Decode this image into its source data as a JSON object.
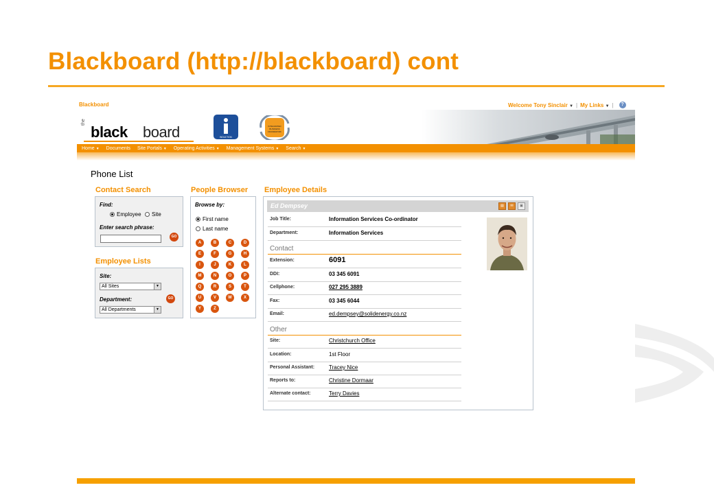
{
  "slide": {
    "title": "Blackboard (http://blackboard) cont"
  },
  "header": {
    "app_name": "Blackboard",
    "welcome": "Welcome Tony Sinclair",
    "my_links": "My Links",
    "logo_the": "the",
    "logo_bold": "black",
    "logo_thin": "board",
    "help_glyph": "?",
    "induction_label": "INDUCTION",
    "ibf_label": "INTEGRATED BUSINESS FRAMEWORK"
  },
  "nav": [
    {
      "label": "Home",
      "dropdown": true
    },
    {
      "label": "Documents",
      "dropdown": false
    },
    {
      "label": "Site Portals",
      "dropdown": true
    },
    {
      "label": "Operating Activities",
      "dropdown": true
    },
    {
      "label": "Management Systems",
      "dropdown": true
    },
    {
      "label": "Search",
      "dropdown": true
    }
  ],
  "page": {
    "heading": "Phone List"
  },
  "contact_search": {
    "title": "Contact Search",
    "find_label": "Find:",
    "option_employee": "Employee",
    "option_site": "Site",
    "phrase_label": "Enter search phrase:",
    "phrase_value": "",
    "go": "GO"
  },
  "employee_lists": {
    "title": "Employee Lists",
    "site_label": "Site:",
    "site_value": "All Sites",
    "department_label": "Department:",
    "department_value": "All Departments",
    "go": "GO"
  },
  "people_browser": {
    "title": "People Browser",
    "browse_label": "Browse by:",
    "option_first": "First name",
    "option_last": "Last name",
    "letters": [
      "A",
      "B",
      "C",
      "D",
      "E",
      "F",
      "G",
      "H",
      "I",
      "J",
      "K",
      "L",
      "M",
      "N",
      "O",
      "P",
      "Q",
      "R",
      "S",
      "T",
      "U",
      "V",
      "W",
      "X",
      "Y",
      "Z"
    ]
  },
  "employee_details": {
    "title": "Employee Details",
    "name": "Ed Dempsey",
    "job_title_label": "Job Title:",
    "job_title": "Information Services Co-ordinator",
    "department_label": "Department:",
    "department": "Information Services",
    "contact_heading": "Contact",
    "extension_label": "Extension:",
    "extension": "6091",
    "ddi_label": "DDI:",
    "ddi": "03 345 6091",
    "cellphone_label": "Cellphone:",
    "cellphone": "027 295 3889",
    "fax_label": "Fax:",
    "fax": "03 345 6044",
    "email_label": "Email:",
    "email": "ed.dempsey@solidenergy.co.nz",
    "other_heading": "Other",
    "site_label": "Site:",
    "site": "Christchurch Office",
    "location_label": "Location:",
    "location": "1st Floor",
    "pa_label": "Personal Assistant:",
    "pa": "Tracey Nice",
    "reports_label": "Reports to:",
    "reports": "Christine Dormaar",
    "alt_label": "Alternate contact:",
    "alt": "Terry Davies"
  },
  "colors": {
    "accent": "#f39000",
    "go_button": "#d2480e",
    "letter_button": "#d9560f"
  }
}
